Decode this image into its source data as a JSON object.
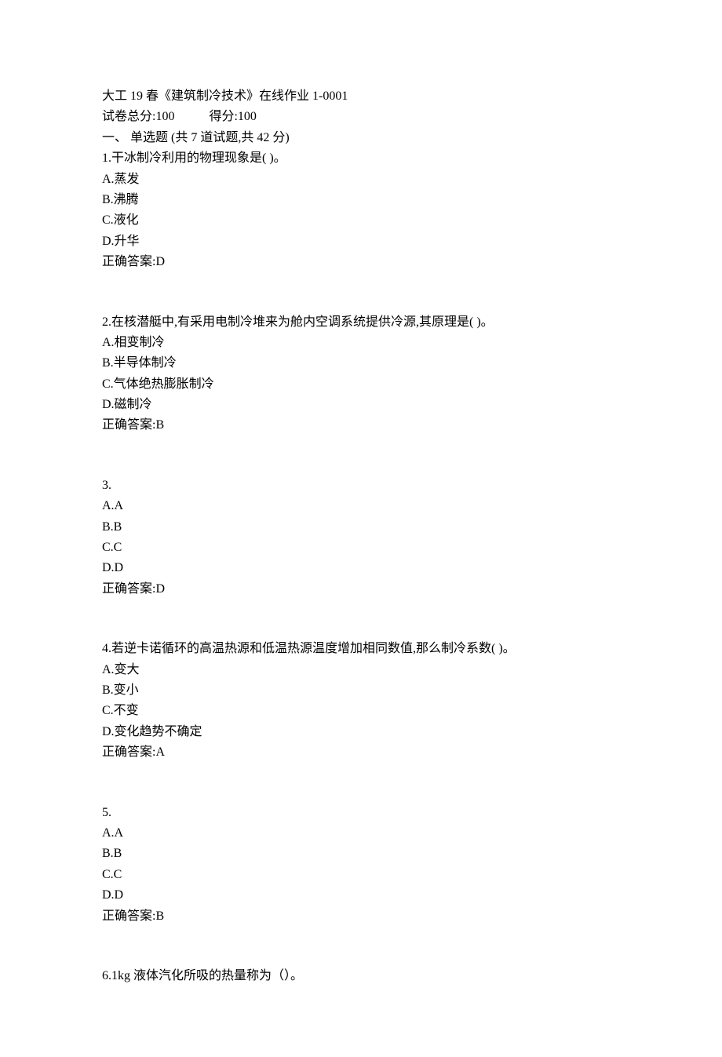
{
  "header": {
    "title": "大工 19 春《建筑制冷技术》在线作业 1-0001",
    "total_label": "试卷总分:100",
    "score_label": "得分:100",
    "section_label": "一、  单选题 (共 7 道试题,共 42 分)"
  },
  "questions": [
    {
      "stem": "1.干冰制冷利用的物理现象是( )。",
      "options": [
        "A.蒸发",
        "B.沸腾",
        "C.液化",
        "D.升华"
      ],
      "answer": "正确答案:D"
    },
    {
      "stem": "2.在核潜艇中,有采用电制冷堆来为舱内空调系统提供冷源,其原理是( )。",
      "options": [
        "A.相变制冷",
        "B.半导体制冷",
        "C.气体绝热膨胀制冷",
        "D.磁制冷"
      ],
      "answer": "正确答案:B"
    },
    {
      "stem": "3.",
      "options": [
        "A.A",
        "B.B",
        "C.C",
        "D.D"
      ],
      "answer": "正确答案:D"
    },
    {
      "stem": "4.若逆卡诺循环的高温热源和低温热源温度增加相同数值,那么制冷系数( )。",
      "options": [
        "A.变大",
        "B.变小",
        "C.不变",
        "D.变化趋势不确定"
      ],
      "answer": "正确答案:A"
    },
    {
      "stem": "5.",
      "options": [
        "A.A",
        "B.B",
        "C.C",
        "D.D"
      ],
      "answer": "正确答案:B"
    },
    {
      "stem": "6.1kg 液体汽化所吸的热量称为（）。",
      "options": [],
      "answer": ""
    }
  ]
}
